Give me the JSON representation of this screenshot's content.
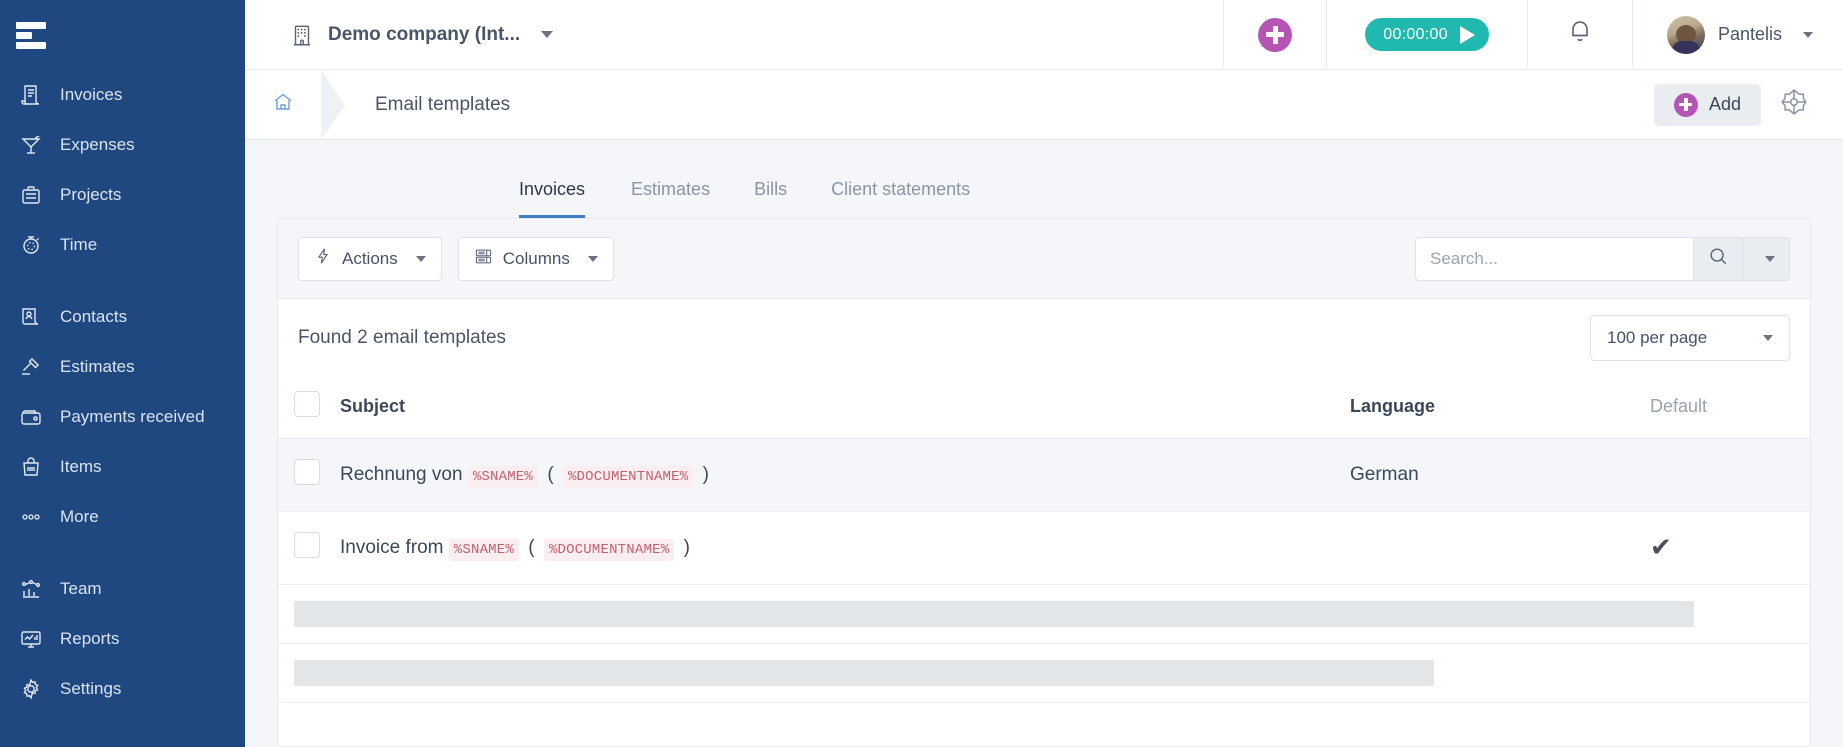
{
  "sidebar": {
    "logo": "hamburger-logo",
    "items": [
      {
        "label": "Invoices",
        "icon": "invoice-icon"
      },
      {
        "label": "Expenses",
        "icon": "cocktail-icon"
      },
      {
        "label": "Projects",
        "icon": "briefcase-icon"
      },
      {
        "label": "Time",
        "icon": "stopwatch-icon"
      },
      {
        "label": "Contacts",
        "icon": "contacts-icon"
      },
      {
        "label": "Estimates",
        "icon": "gavel-icon"
      },
      {
        "label": "Payments received",
        "icon": "wallet-icon"
      },
      {
        "label": "Items",
        "icon": "items-bag-icon"
      },
      {
        "label": "More",
        "icon": "ellipsis-icon"
      },
      {
        "label": "Team",
        "icon": "team-chart-icon"
      },
      {
        "label": "Reports",
        "icon": "monitor-report-icon"
      },
      {
        "label": "Settings",
        "icon": "gear-icon"
      }
    ]
  },
  "topbar": {
    "company_name": "Demo company (Int...",
    "company_icon": "building-icon",
    "add_icon": "plus-circle-icon",
    "timer_value": "00:00:00",
    "timer_play_icon": "play-icon",
    "bell_icon": "bell-icon",
    "user_name": "Pantelis",
    "avatar": "user-avatar"
  },
  "breadcrumb": {
    "home_icon": "home-icon",
    "title": "Email templates",
    "add_label": "Add",
    "add_icon": "plus-circle-icon",
    "settings_icon": "compass-widget-icon"
  },
  "tabs": [
    {
      "label": "Invoices",
      "active": true
    },
    {
      "label": "Estimates",
      "active": false
    },
    {
      "label": "Bills",
      "active": false
    },
    {
      "label": "Client statements",
      "active": false
    }
  ],
  "toolbar": {
    "actions_label": "Actions",
    "actions_icon": "bolt-icon",
    "columns_label": "Columns",
    "columns_icon": "columns-icon",
    "search_placeholder": "Search...",
    "search_value": "",
    "search_icon": "search-icon"
  },
  "meta": {
    "found_text": "Found 2 email templates",
    "per_page_label": "100 per page"
  },
  "table": {
    "headers": {
      "subject": "Subject",
      "language": "Language",
      "default": "Default"
    },
    "rows": [
      {
        "subject_prefix": "Rechnung von",
        "token1": "%SNAME%",
        "paren_open": "(",
        "token2": "%DOCUMENTNAME%",
        "paren_close": ")",
        "language": "German",
        "is_default": false
      },
      {
        "subject_prefix": "Invoice from",
        "token1": "%SNAME%",
        "paren_open": "(",
        "token2": "%DOCUMENTNAME%",
        "paren_close": ")",
        "language": "",
        "is_default": true
      }
    ],
    "default_check_glyph": "✔"
  },
  "colors": {
    "sidebar_bg": "#1f4780",
    "accent_purple": "#b455b4",
    "accent_teal": "#20b9b0",
    "tab_underline": "#3f7cc4",
    "token_text": "#c0616f",
    "token_bg": "#fbeef0",
    "page_bg": "#f4f6f9"
  }
}
